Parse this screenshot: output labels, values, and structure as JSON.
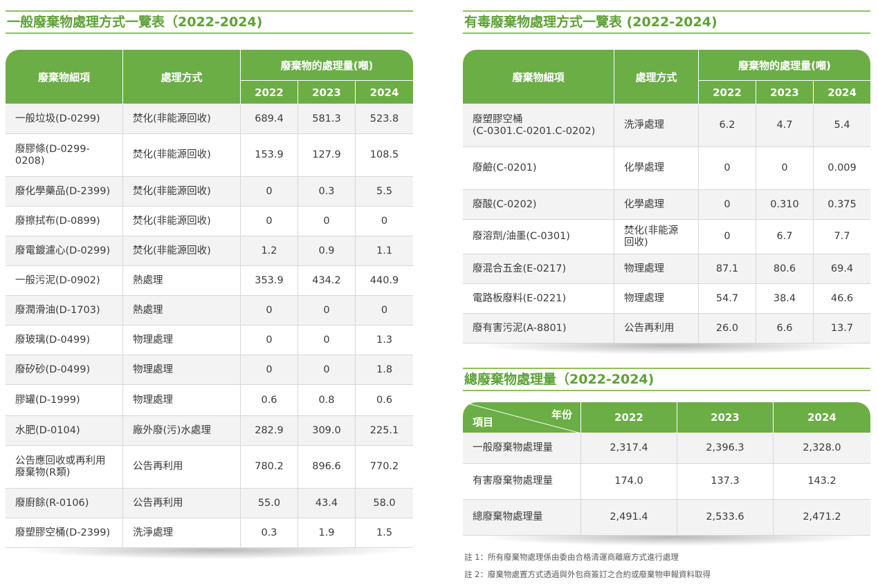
{
  "general": {
    "title": "一般廢棄物處理方式一覽表（2022-2024)",
    "headers": {
      "item": "廢棄物細項",
      "method": "處理方式",
      "amount": "廢棄物的處理量(噸)",
      "y1": "2022",
      "y2": "2023",
      "y3": "2024"
    },
    "rows": [
      {
        "name": "一般垃圾(D-0299)",
        "method": "焚化(非能源回收)",
        "v2022": "689.4",
        "v2023": "581.3",
        "v2024": "523.8"
      },
      {
        "name": "廢膠條(D-0299-\n0208)",
        "method": "焚化(非能源回收)",
        "v2022": "153.9",
        "v2023": "127.9",
        "v2024": "108.5"
      },
      {
        "name": "廢化學藥品(D-2399)",
        "method": "焚化(非能源回收)",
        "v2022": "0",
        "v2023": "0.3",
        "v2024": "5.5"
      },
      {
        "name": "廢擦拭布(D-0899)",
        "method": "焚化(非能源回收)",
        "v2022": "0",
        "v2023": "0",
        "v2024": "0"
      },
      {
        "name": "廢電鍍濾心(D-0299)",
        "method": "焚化(非能源回收)",
        "v2022": "1.2",
        "v2023": "0.9",
        "v2024": "1.1"
      },
      {
        "name": "一般污泥(D-0902)",
        "method": "熱處理",
        "v2022": "353.9",
        "v2023": "434.2",
        "v2024": "440.9"
      },
      {
        "name": "廢潤滑油(D-1703)",
        "method": "熱處理",
        "v2022": "0",
        "v2023": "0",
        "v2024": "0"
      },
      {
        "name": "廢玻璃(D-0499)",
        "method": "物理處理",
        "v2022": "0",
        "v2023": "0",
        "v2024": "1.3"
      },
      {
        "name": "廢矽砂(D-0499)",
        "method": "物理處理",
        "v2022": "0",
        "v2023": "0",
        "v2024": "1.8"
      },
      {
        "name": "膠罐(D-1999)",
        "method": "物理處理",
        "v2022": "0.6",
        "v2023": "0.8",
        "v2024": "0.6"
      },
      {
        "name": "水肥(D-0104)",
        "method": "廠外廢(污)水處理",
        "v2022": "282.9",
        "v2023": "309.0",
        "v2024": "225.1"
      },
      {
        "name": "公告應回收或再利用\n廢棄物(R類)",
        "method": "公告再利用",
        "v2022": "780.2",
        "v2023": "896.6",
        "v2024": "770.2"
      },
      {
        "name": "廢廚餘(R-0106)",
        "method": "公告再利用",
        "v2022": "55.0",
        "v2023": "43.4",
        "v2024": "58.0"
      },
      {
        "name": "廢塑膠空桶(D-2399)",
        "method": "洗淨處理",
        "v2022": "0.3",
        "v2023": "1.9",
        "v2024": "1.5"
      }
    ]
  },
  "toxic": {
    "title": "有毒廢棄物處理方式一覽表 (2022-2024)",
    "headers": {
      "item": "廢棄物細項",
      "method": "處理方式",
      "amount": "廢棄物的處理量(噸)",
      "y1": "2022",
      "y2": "2023",
      "y3": "2024"
    },
    "rows": [
      {
        "name": "廢塑膠空桶\n(C-0301.C-0201.C-0202)",
        "method": "洗淨處理",
        "v2022": "6.2",
        "v2023": "4.7",
        "v2024": "5.4"
      },
      {
        "name": "廢鹼(C-0201)",
        "method": "化學處理",
        "v2022": "0",
        "v2023": "0",
        "v2024": "0.009"
      },
      {
        "name": "廢酸(C-0202)",
        "method": "化學處理",
        "v2022": "0",
        "v2023": "0.310",
        "v2024": "0.375"
      },
      {
        "name": "廢溶劑/油墨(C-0301)",
        "method": "焚化(非能源\n回收)",
        "v2022": "0",
        "v2023": "6.7",
        "v2024": "7.7"
      },
      {
        "name": "廢混合五金(E-0217)",
        "method": "物理處理",
        "v2022": "87.1",
        "v2023": "80.6",
        "v2024": "69.4"
      },
      {
        "name": "電路板廢料(E-0221)",
        "method": "物理處理",
        "v2022": "54.7",
        "v2023": "38.4",
        "v2024": "46.6"
      },
      {
        "name": "廢有害污泥(A-8801)",
        "method": "公告再利用",
        "v2022": "26.0",
        "v2023": "6.6",
        "v2024": "13.7"
      }
    ]
  },
  "total": {
    "title": "總廢棄物處理量（2022-2024)",
    "headers": {
      "year_label": "年份",
      "item_label": "項目",
      "y1": "2022",
      "y2": "2023",
      "y3": "2024"
    },
    "rows": [
      {
        "name": "一般廢棄物處理量",
        "v2022": "2,317.4",
        "v2023": "2,396.3",
        "v2024": "2,328.0"
      },
      {
        "name": "有害廢棄物處理量",
        "v2022": "174.0",
        "v2023": "137.3",
        "v2024": "143.2"
      },
      {
        "name": "總廢棄物處理量",
        "v2022": "2,491.4",
        "v2023": "2,533.6",
        "v2024": "2,471.2"
      }
    ]
  },
  "notes": {
    "note1": "註 1：所有廢棄物處理係由委由合格清運商離廠方式進行處理",
    "note2": "註 2：廢棄物處置方式透過與外包商簽訂之合約或廢棄物申報資料取得"
  },
  "colors": {
    "header_green": "#6aae45",
    "title_green": "#5ea137",
    "rule_green": "#8dc15c",
    "row_gray": "#f3f3f3"
  }
}
